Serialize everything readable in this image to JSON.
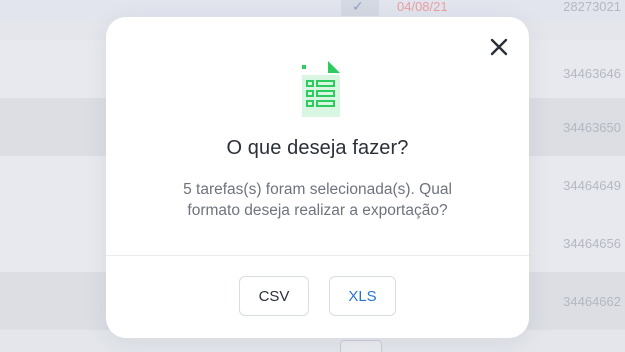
{
  "background": {
    "top_row": {
      "date": "04/08/21",
      "id": "28273021",
      "check_icon": "check-icon"
    },
    "row_ids": [
      "34463646",
      "34463650",
      "34464649",
      "34464656",
      "34464662"
    ]
  },
  "modal": {
    "close_icon": "close-icon",
    "file_icon": "spreadsheet-file-icon",
    "title": "O que deseja fazer?",
    "message_line1": "5 tarefas(s) foram selecionada(s). Qual",
    "message_line2": "formato deseja realizar a exportação?",
    "buttons": {
      "csv": "CSV",
      "xls": "XLS"
    }
  },
  "colors": {
    "icon_green": "#2ecc5e",
    "link_blue": "#2a73d6",
    "date_red": "#e8a0a4"
  }
}
